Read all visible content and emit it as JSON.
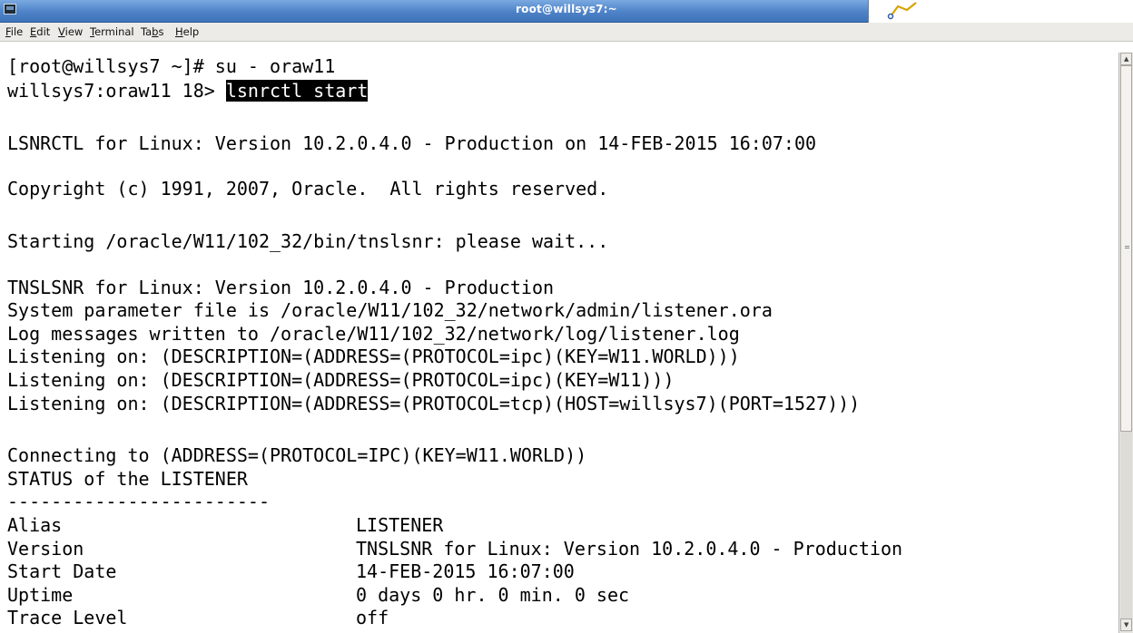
{
  "window": {
    "title": "root@willsys7:~",
    "menu": [
      {
        "pre": "",
        "u": "F",
        "post": "ile"
      },
      {
        "pre": "",
        "u": "E",
        "post": "dit"
      },
      {
        "pre": "",
        "u": "V",
        "post": "iew"
      },
      {
        "pre": "",
        "u": "T",
        "post": "erminal"
      },
      {
        "pre": "Ta",
        "u": "b",
        "post": "s"
      },
      {
        "pre": "",
        "u": "H",
        "post": "elp"
      }
    ]
  },
  "terminal": {
    "prompt1": "[root@willsys7 ~]# su - oraw11",
    "prompt2": "willsys7:oraw11 18> ",
    "command": "lsnrctl start",
    "lines": [
      "LSNRCTL for Linux: Version 10.2.0.4.0 - Production on 14-FEB-2015 16:07:00",
      "Copyright (c) 1991, 2007, Oracle.  All rights reserved.",
      "Starting /oracle/W11/102_32/bin/tnslsnr: please wait...",
      "TNSLSNR for Linux: Version 10.2.0.4.0 - Production",
      "System parameter file is /oracle/W11/102_32/network/admin/listener.ora",
      "Log messages written to /oracle/W11/102_32/network/log/listener.log",
      "Listening on: (DESCRIPTION=(ADDRESS=(PROTOCOL=ipc)(KEY=W11.WORLD)))",
      "Listening on: (DESCRIPTION=(ADDRESS=(PROTOCOL=ipc)(KEY=W11)))",
      "Listening on: (DESCRIPTION=(ADDRESS=(PROTOCOL=tcp)(HOST=willsys7)(PORT=1527)))",
      "Connecting to (ADDRESS=(PROTOCOL=IPC)(KEY=W11.WORLD))",
      "STATUS of the LISTENER",
      "------------------------"
    ],
    "status": [
      {
        "key": "Alias",
        "value": "LISTENER"
      },
      {
        "key": "Version",
        "value": "TNSLSNR for Linux: Version 10.2.0.4.0 - Production"
      },
      {
        "key": "Start Date",
        "value": "14-FEB-2015 16:07:00"
      },
      {
        "key": "Uptime",
        "value": "0 days 0 hr. 0 min. 0 sec"
      },
      {
        "key": "Trace Level",
        "value": "off"
      }
    ]
  },
  "icons": {
    "window_icon": "terminal-window-icon",
    "overlay": "graph-curve-icon",
    "scroll_up": "arrow-up-icon",
    "scroll_down": "arrow-down-icon"
  },
  "colors": {
    "titlebar": "#4d82c8",
    "terminal_bg": "#ffffff",
    "terminal_fg": "#000000",
    "highlight_bg": "#000000"
  }
}
